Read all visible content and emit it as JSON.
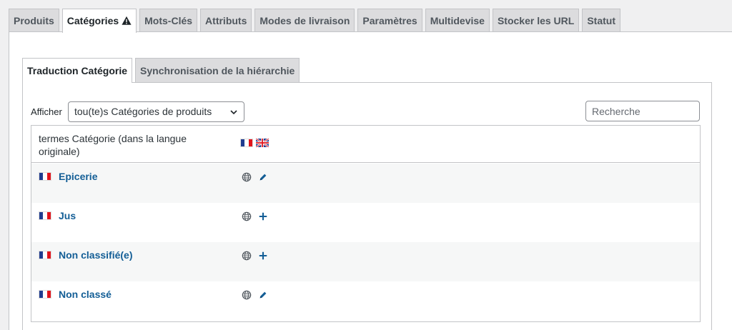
{
  "top_tabs": [
    {
      "label": "Produits",
      "active": false
    },
    {
      "label": "Catégories",
      "active": true,
      "icon": "warning-icon"
    },
    {
      "label": "Mots-Clés",
      "active": false
    },
    {
      "label": "Attributs",
      "active": false
    },
    {
      "label": "Modes de livraison",
      "active": false
    },
    {
      "label": "Paramètres",
      "active": false
    },
    {
      "label": "Multidevise",
      "active": false
    },
    {
      "label": "Stocker les URL",
      "active": false
    },
    {
      "label": "Statut",
      "active": false
    }
  ],
  "sub_tabs": [
    {
      "label": "Traduction Catégorie",
      "active": true
    },
    {
      "label": "Synchronisation de la hiérarchie",
      "active": false
    }
  ],
  "filter": {
    "label": "Afficher",
    "selected": "tou(te)s Catégories de produits"
  },
  "search": {
    "placeholder": "Recherche"
  },
  "table": {
    "header_title": "termes Catégorie (dans la langue originale)",
    "header_flags": [
      "flag-fr-icon",
      "flag-uk-icon"
    ],
    "rows": [
      {
        "name": "Epicerie",
        "action": "pencil-icon"
      },
      {
        "name": "Jus",
        "action": "plus-icon"
      },
      {
        "name": "Non classifié(e)",
        "action": "plus-icon"
      },
      {
        "name": "Non classé",
        "action": "pencil-icon"
      }
    ]
  },
  "colors": {
    "link": "#135e96",
    "tab_inactive": "#dcdcde",
    "border": "#c3c4c7",
    "row_alt": "#f6f7f7"
  }
}
